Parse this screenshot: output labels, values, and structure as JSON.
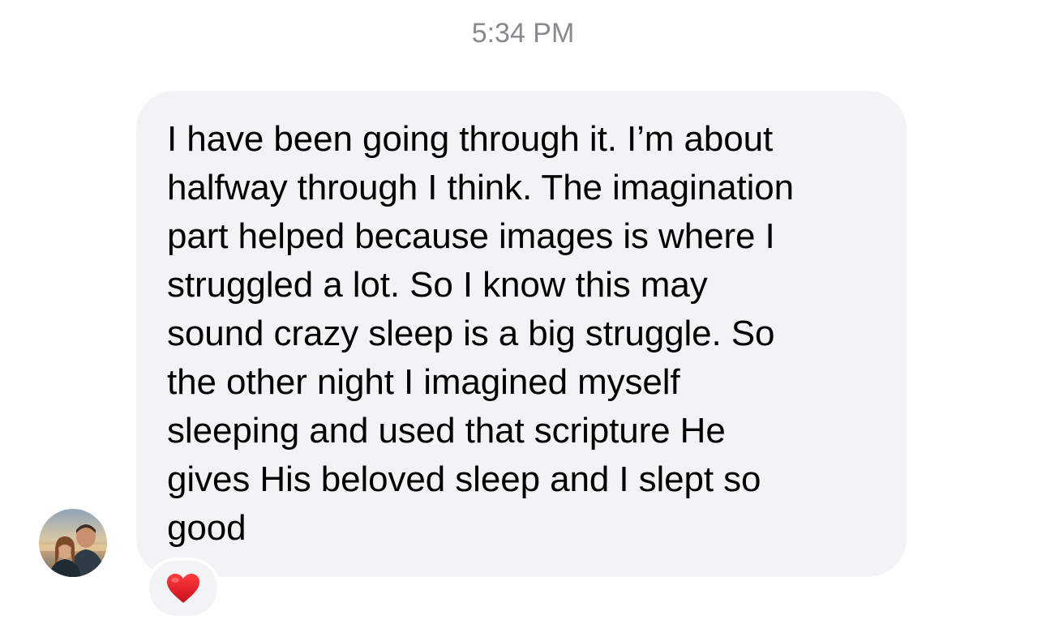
{
  "thread": {
    "timestamp": "5:34 PM"
  },
  "message": {
    "lines": [
      "I have been going through it. I’m about",
      "halfway through I think. The imagination",
      "part helped because images is where I",
      "struggled a lot. So I know this may",
      "sound crazy sleep is a big struggle. So",
      "the other night I imagined myself",
      "sleeping and used that scripture He",
      "gives His beloved sleep and I slept so",
      "good"
    ],
    "reaction": {
      "icon": "heart-icon",
      "color": "#e0191f"
    }
  },
  "colors": {
    "bubble": "#f2f3f5",
    "timestamp": "#8a8a8e",
    "text": "#000000"
  }
}
